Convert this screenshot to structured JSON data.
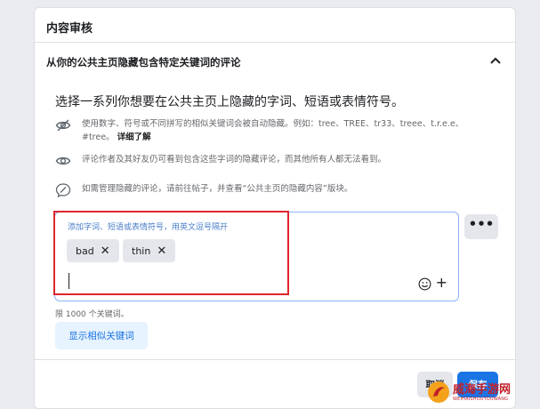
{
  "card": {
    "title": "内容审核",
    "section_title": "从你的公共主页隐藏包含特定关键词的评论"
  },
  "content": {
    "intro": "选择一系列你想要在公共主页上隐藏的字词、短语或表情符号。",
    "info_items": [
      {
        "icon": "eye-slash-icon",
        "text": "使用数字、符号或不同拼写的相似关键词会被自动隐藏。例如：tree、TREE、tr33、treee、t.r.e.e、#tree。",
        "link": "详细了解"
      },
      {
        "icon": "eye-icon",
        "text": "评论作者及其好友仍可看到包含这些字词的隐藏评论，而其他所有人都无法看到。"
      },
      {
        "icon": "comment-hidden-icon",
        "text": "如需管理隐藏的评论，请前往帖子，并查看“公共主页的隐藏内容”版块。"
      }
    ]
  },
  "keywords": {
    "placeholder": "添加字词、短语或表情符号，用英文逗号隔开",
    "chips": [
      "bad",
      "thin"
    ],
    "remove_glyph": "✕",
    "more_label": "•••",
    "add_label": "+",
    "limit_text": "限 1000 个关键词。",
    "similar_button": "显示相似关键词"
  },
  "footer": {
    "cancel": "取消",
    "save": "保存"
  },
  "watermark": {
    "main": "威海手游网",
    "sub": "WEIHAISHOUYOUWANG"
  },
  "colors": {
    "accent": "#1b74e4",
    "highlight": "#e0252c"
  }
}
